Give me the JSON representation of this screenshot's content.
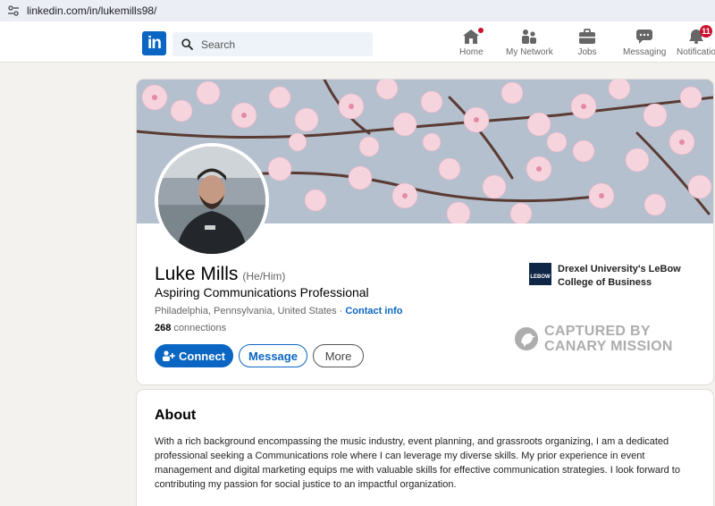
{
  "browser": {
    "url": "linkedin.com/in/lukemills98/"
  },
  "nav": {
    "logo_text": "in",
    "search_placeholder": "Search",
    "items": [
      {
        "label": "Home",
        "icon": "home-icon",
        "badge": ""
      },
      {
        "label": "My Network",
        "icon": "network-icon",
        "badge": ""
      },
      {
        "label": "Jobs",
        "icon": "briefcase-icon",
        "badge": ""
      },
      {
        "label": "Messaging",
        "icon": "chat-icon",
        "badge": ""
      },
      {
        "label": "Notificatio",
        "icon": "bell-icon",
        "badge": "11"
      }
    ]
  },
  "profile": {
    "name": "Luke Mills",
    "pronouns": "(He/Him)",
    "headline": "Aspiring Communications Professional",
    "location": "Philadelphia, Pennsylvania, United States",
    "location_separator": "·",
    "contact_info": "Contact info",
    "connections_count": "268",
    "connections_label": "connections",
    "education": "Drexel University's LeBow College of Business",
    "education_logo_text": "LEBOW",
    "buttons": {
      "connect": "Connect",
      "message": "Message",
      "more": "More"
    },
    "watermark_line1": "CAPTURED BY",
    "watermark_line2": "CANARY MISSION"
  },
  "about": {
    "title": "About",
    "text": "With a rich background encompassing the music industry, event planning, and grassroots organizing, I am a dedicated professional seeking a Communications role where I can leverage my diverse skills. My prior experience in event management and digital marketing equips me with valuable skills for effective communication strategies. I look forward to contributing my passion for social justice to an impactful organization."
  },
  "colors": {
    "brand": "#0a66c2",
    "badge": "#cb112d",
    "page_bg": "#f4f2ee"
  }
}
